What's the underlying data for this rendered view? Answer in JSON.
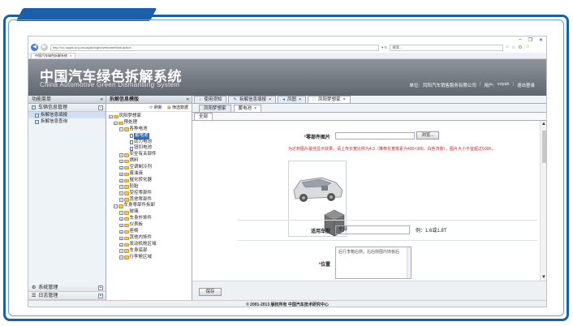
{
  "browser": {
    "url": "http://xx.cagds.org.cn/cagds/login/welcomeMain.action",
    "search_placeholder": "搜索...",
    "tab_title": "中国汽车绿色拆解系统",
    "win_min": "–",
    "win_max": "❐",
    "win_close": "✕"
  },
  "header": {
    "title": "中国汽车绿色拆解系统",
    "subtitle": "China Automotive Green Dismantling System",
    "unit_label": "单位:",
    "unit_value": "凤阳汽车销售服务有限公司",
    "user_label": "用户:",
    "user_value": "voyah",
    "logout": "退出登录"
  },
  "left_menu": {
    "title": "功能菜单",
    "collapse": "«",
    "group1": "车辆信息管理",
    "group1_toggle": "−",
    "items": [
      {
        "label": "拆解信息填报"
      },
      {
        "label": "拆解信息查询"
      }
    ],
    "group2": "系统管理",
    "group3": "日志管理",
    "toggle_plus": "+"
  },
  "mid_panel": {
    "title": "拆解信息模版",
    "collapse": "«",
    "refresh": "刷新",
    "filter": "筛选数据",
    "tree": [
      {
        "label": "凤阳梦想家",
        "level": 0
      },
      {
        "label": "预处理",
        "level": 1
      },
      {
        "label": "各种电池",
        "level": 2
      },
      {
        "label": "蓄电池",
        "level": 3
      },
      {
        "label": "动力电池",
        "level": 3
      },
      {
        "label": "钮扣电池",
        "level": 3
      },
      {
        "label": "安全有关部件",
        "level": 2
      },
      {
        "label": "燃料",
        "level": 2
      },
      {
        "label": "空调制冷剂",
        "level": 2
      },
      {
        "label": "废油液",
        "level": 2
      },
      {
        "label": "催化转化器",
        "level": 2
      },
      {
        "label": "轮胎",
        "level": 2
      },
      {
        "label": "受控零部件",
        "level": 2
      },
      {
        "label": "其他零部件",
        "level": 2
      },
      {
        "label": "车身零部件拆卸",
        "level": 1
      },
      {
        "label": "玻璃",
        "level": 2
      },
      {
        "label": "车身外饰件",
        "level": 2
      },
      {
        "label": "仪表板",
        "level": 2
      },
      {
        "label": "座椅",
        "level": 2
      },
      {
        "label": "其他内饰件",
        "level": 2
      },
      {
        "label": "发动机舱区域",
        "level": 2
      },
      {
        "label": "车身底部",
        "level": 2
      },
      {
        "label": "行李舱区域",
        "level": 2
      }
    ]
  },
  "right": {
    "top_tabs": [
      {
        "label": "使用须知"
      },
      {
        "label": "拆解信息填报"
      },
      {
        "label": "凤图"
      },
      {
        "label": "凤阳梦想家"
      }
    ],
    "sub_tabs": [
      {
        "label": "凤阳梦想家"
      },
      {
        "label": "蓄电池"
      }
    ],
    "inner_tab": "全部",
    "form": {
      "image_label": "零部件图片",
      "browse": "浏览...",
      "hint": "为达到图片最佳显示效果，请上传长宽比例为4:3（推荐长宽像素为400×300，白色背景），图片大小不宜超过500K。",
      "model_label": "适用车型",
      "model_value": "全部",
      "example": "例：1.6或1.8T",
      "position_label": "位置",
      "position_value": "后行李箱右侧，右后侧围内饰板后"
    },
    "save": "保存",
    "footer": "© 2001-2013 版权所有  中国汽车技术研究中心"
  }
}
